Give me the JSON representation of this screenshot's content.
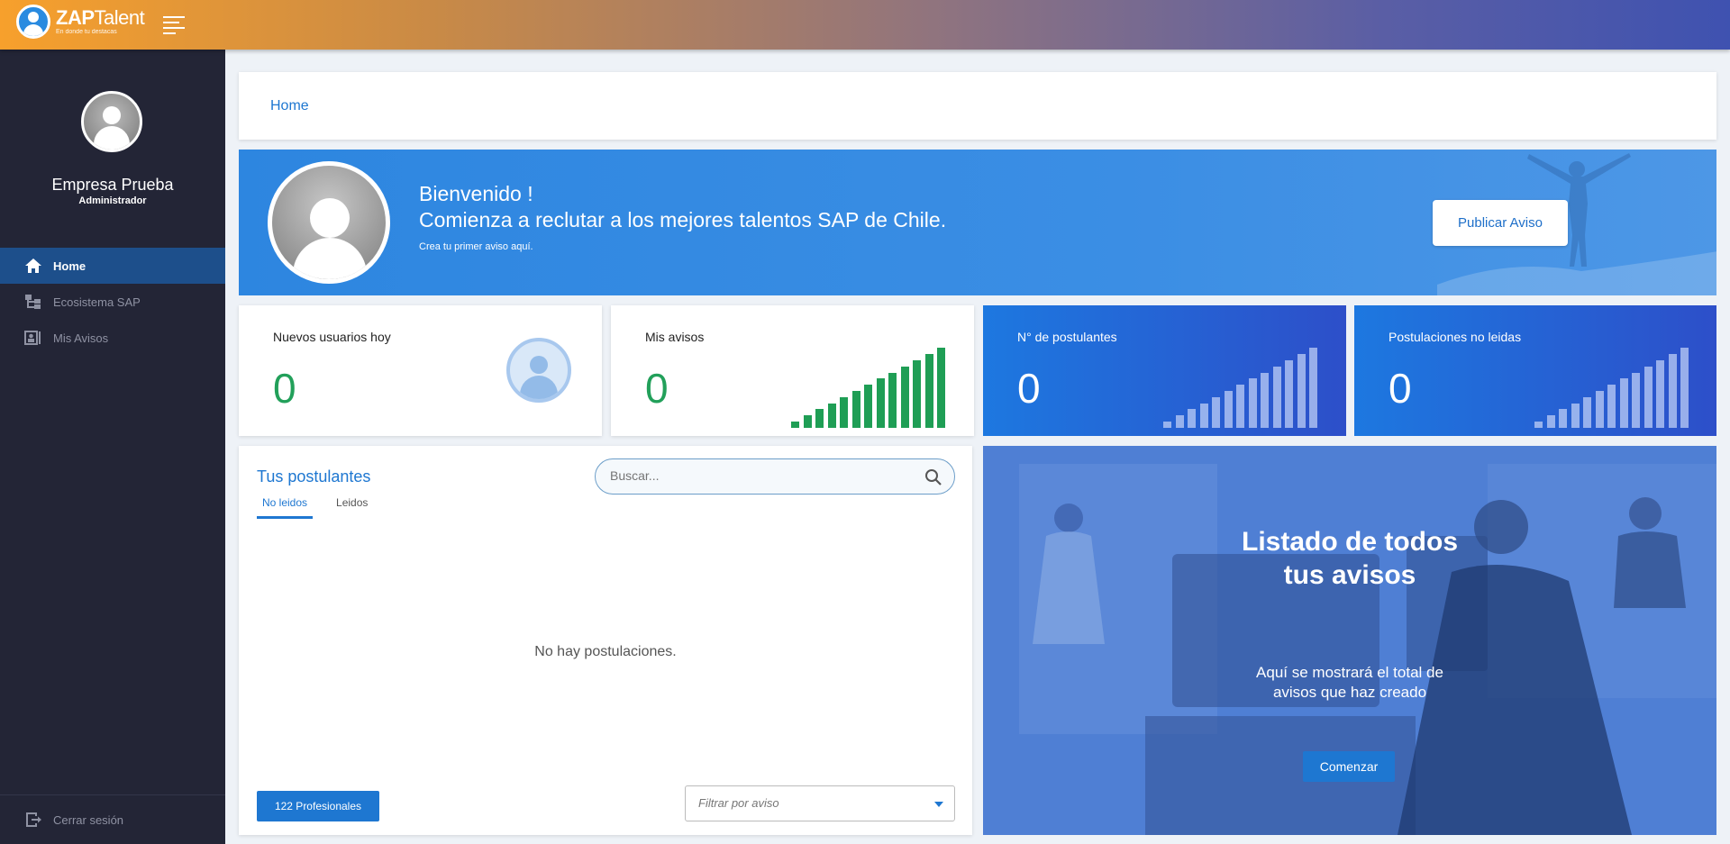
{
  "header": {
    "logo_bold": "ZAP",
    "logo_thin": "Talent",
    "logo_tagline": "En donde tu destacas"
  },
  "sidebar": {
    "company": "Empresa Prueba",
    "role": "Administrador",
    "items": [
      {
        "label": "Home",
        "icon": "home-icon",
        "active": true
      },
      {
        "label": "Ecosistema SAP",
        "icon": "hierarchy-icon",
        "active": false
      },
      {
        "label": "Mis Avisos",
        "icon": "id-card-icon",
        "active": false
      }
    ],
    "logout_label": "Cerrar sesión"
  },
  "breadcrumb": "Home",
  "welcome": {
    "title": "Bienvenido !",
    "subtitle": "Comienza a reclutar a los mejores talentos SAP de Chile.",
    "small": "Crea tu primer aviso aquí.",
    "button": "Publicar Aviso"
  },
  "stats": [
    {
      "label": "Nuevos usuarios hoy",
      "value": "0"
    },
    {
      "label": "Mis avisos",
      "value": "0"
    },
    {
      "label": "N° de postulantes",
      "value": "0"
    },
    {
      "label": "Postulaciones no leidas",
      "value": "0"
    }
  ],
  "postulantes": {
    "title": "Tus postulantes",
    "search_placeholder": "Buscar...",
    "tabs": [
      "No leidos",
      "Leidos"
    ],
    "empty_message": "No hay postulaciones.",
    "professionals_button": "122 Profesionales",
    "filter_placeholder": "Filtrar por aviso"
  },
  "promo": {
    "title_line1": "Listado de todos",
    "title_line2": "tus avisos",
    "text_line1": "Aquí se mostrará el total de",
    "text_line2": "avisos que haz creado",
    "button": "Comenzar"
  },
  "colors": {
    "accent": "#1e77d1",
    "sidebar_bg": "#232536",
    "green_value": "#22a05a"
  }
}
